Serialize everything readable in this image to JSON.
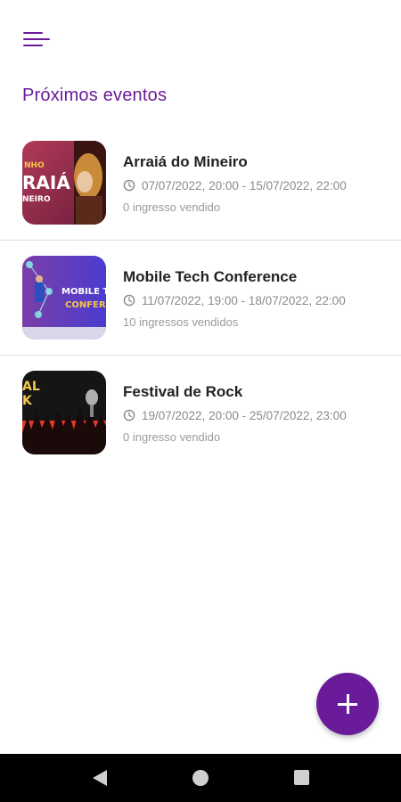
{
  "header": {
    "menu_icon": "hamburger-menu-icon",
    "title": "Próximos eventos"
  },
  "events": [
    {
      "title": "Arraiá do Mineiro",
      "date": "07/07/2022, 20:00 - 15/07/2022, 22:00",
      "tickets": "0 ingresso vendido",
      "thumb_text_top": "NHO",
      "thumb_text_main": "RAIÁ",
      "thumb_text_bottom": "NEIRO"
    },
    {
      "title": "Mobile Tech Conference",
      "date": "11/07/2022, 19:00 - 18/07/2022, 22:00",
      "tickets": "10 ingressos vendidos",
      "thumb_text_top": "MOBILE T",
      "thumb_text_bottom": "CONFER"
    },
    {
      "title": "Festival de Rock",
      "date": "19/07/2022, 20:00 - 25/07/2022, 23:00",
      "tickets": "0 ingresso vendido",
      "thumb_text_top": "AL",
      "thumb_text_bottom": "K"
    }
  ],
  "fab": {
    "icon": "plus-icon"
  },
  "navbar": {
    "back_icon": "back-triangle-icon",
    "home_icon": "home-circle-icon",
    "recents_icon": "recents-square-icon"
  },
  "colors": {
    "accent": "#6a1b9a",
    "title_text": "#222222",
    "secondary_text": "#8a8a8a"
  }
}
